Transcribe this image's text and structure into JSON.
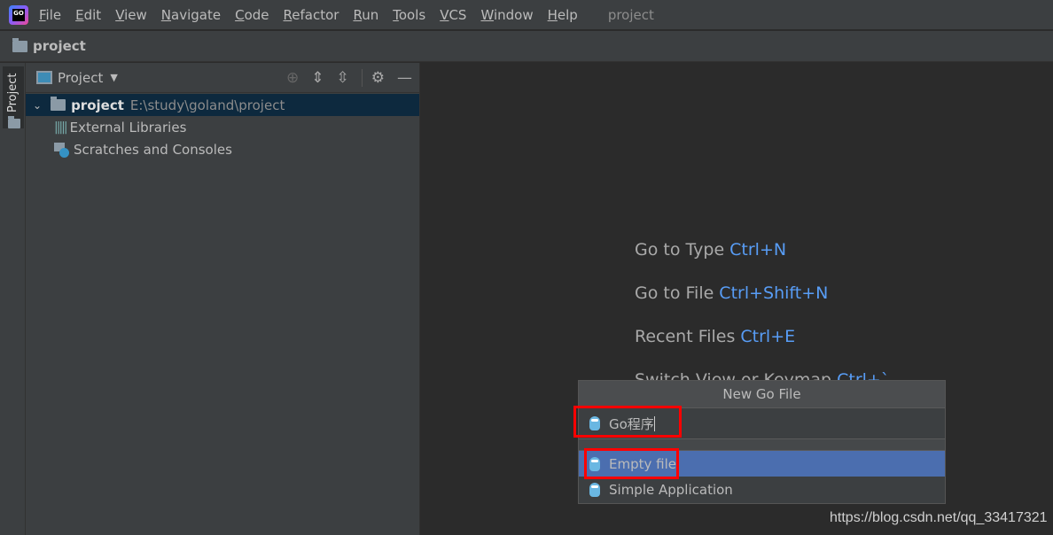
{
  "menubar": {
    "items": [
      "File",
      "Edit",
      "View",
      "Navigate",
      "Code",
      "Refactor",
      "Run",
      "Tools",
      "VCS",
      "Window",
      "Help"
    ],
    "title": "project",
    "logo": "GO"
  },
  "navbar": {
    "title": "project"
  },
  "stripe": {
    "tab": "Project"
  },
  "panel": {
    "selector": "Project",
    "tree": [
      {
        "label": "project",
        "path": "E:\\study\\goland\\project"
      },
      {
        "label": "External Libraries"
      },
      {
        "label": "Scratches and Consoles"
      }
    ]
  },
  "editor": {
    "hints": [
      {
        "label": "Go to Type",
        "key": "Ctrl+N"
      },
      {
        "label": "Go to File",
        "key": "Ctrl+Shift+N"
      },
      {
        "label": "Recent Files",
        "key": "Ctrl+E"
      },
      {
        "label": "Switch View or Keymap",
        "key": "Ctrl+`"
      }
    ]
  },
  "popup": {
    "title": "New Go File",
    "input_value": "Go程序",
    "options": [
      "Empty file",
      "Simple Application"
    ]
  },
  "watermark": "https://blog.csdn.net/qq_33417321",
  "colors": {
    "selection": "#4b6eaf",
    "shortcut": "#589df6",
    "highlight_box": "#ff0000"
  }
}
